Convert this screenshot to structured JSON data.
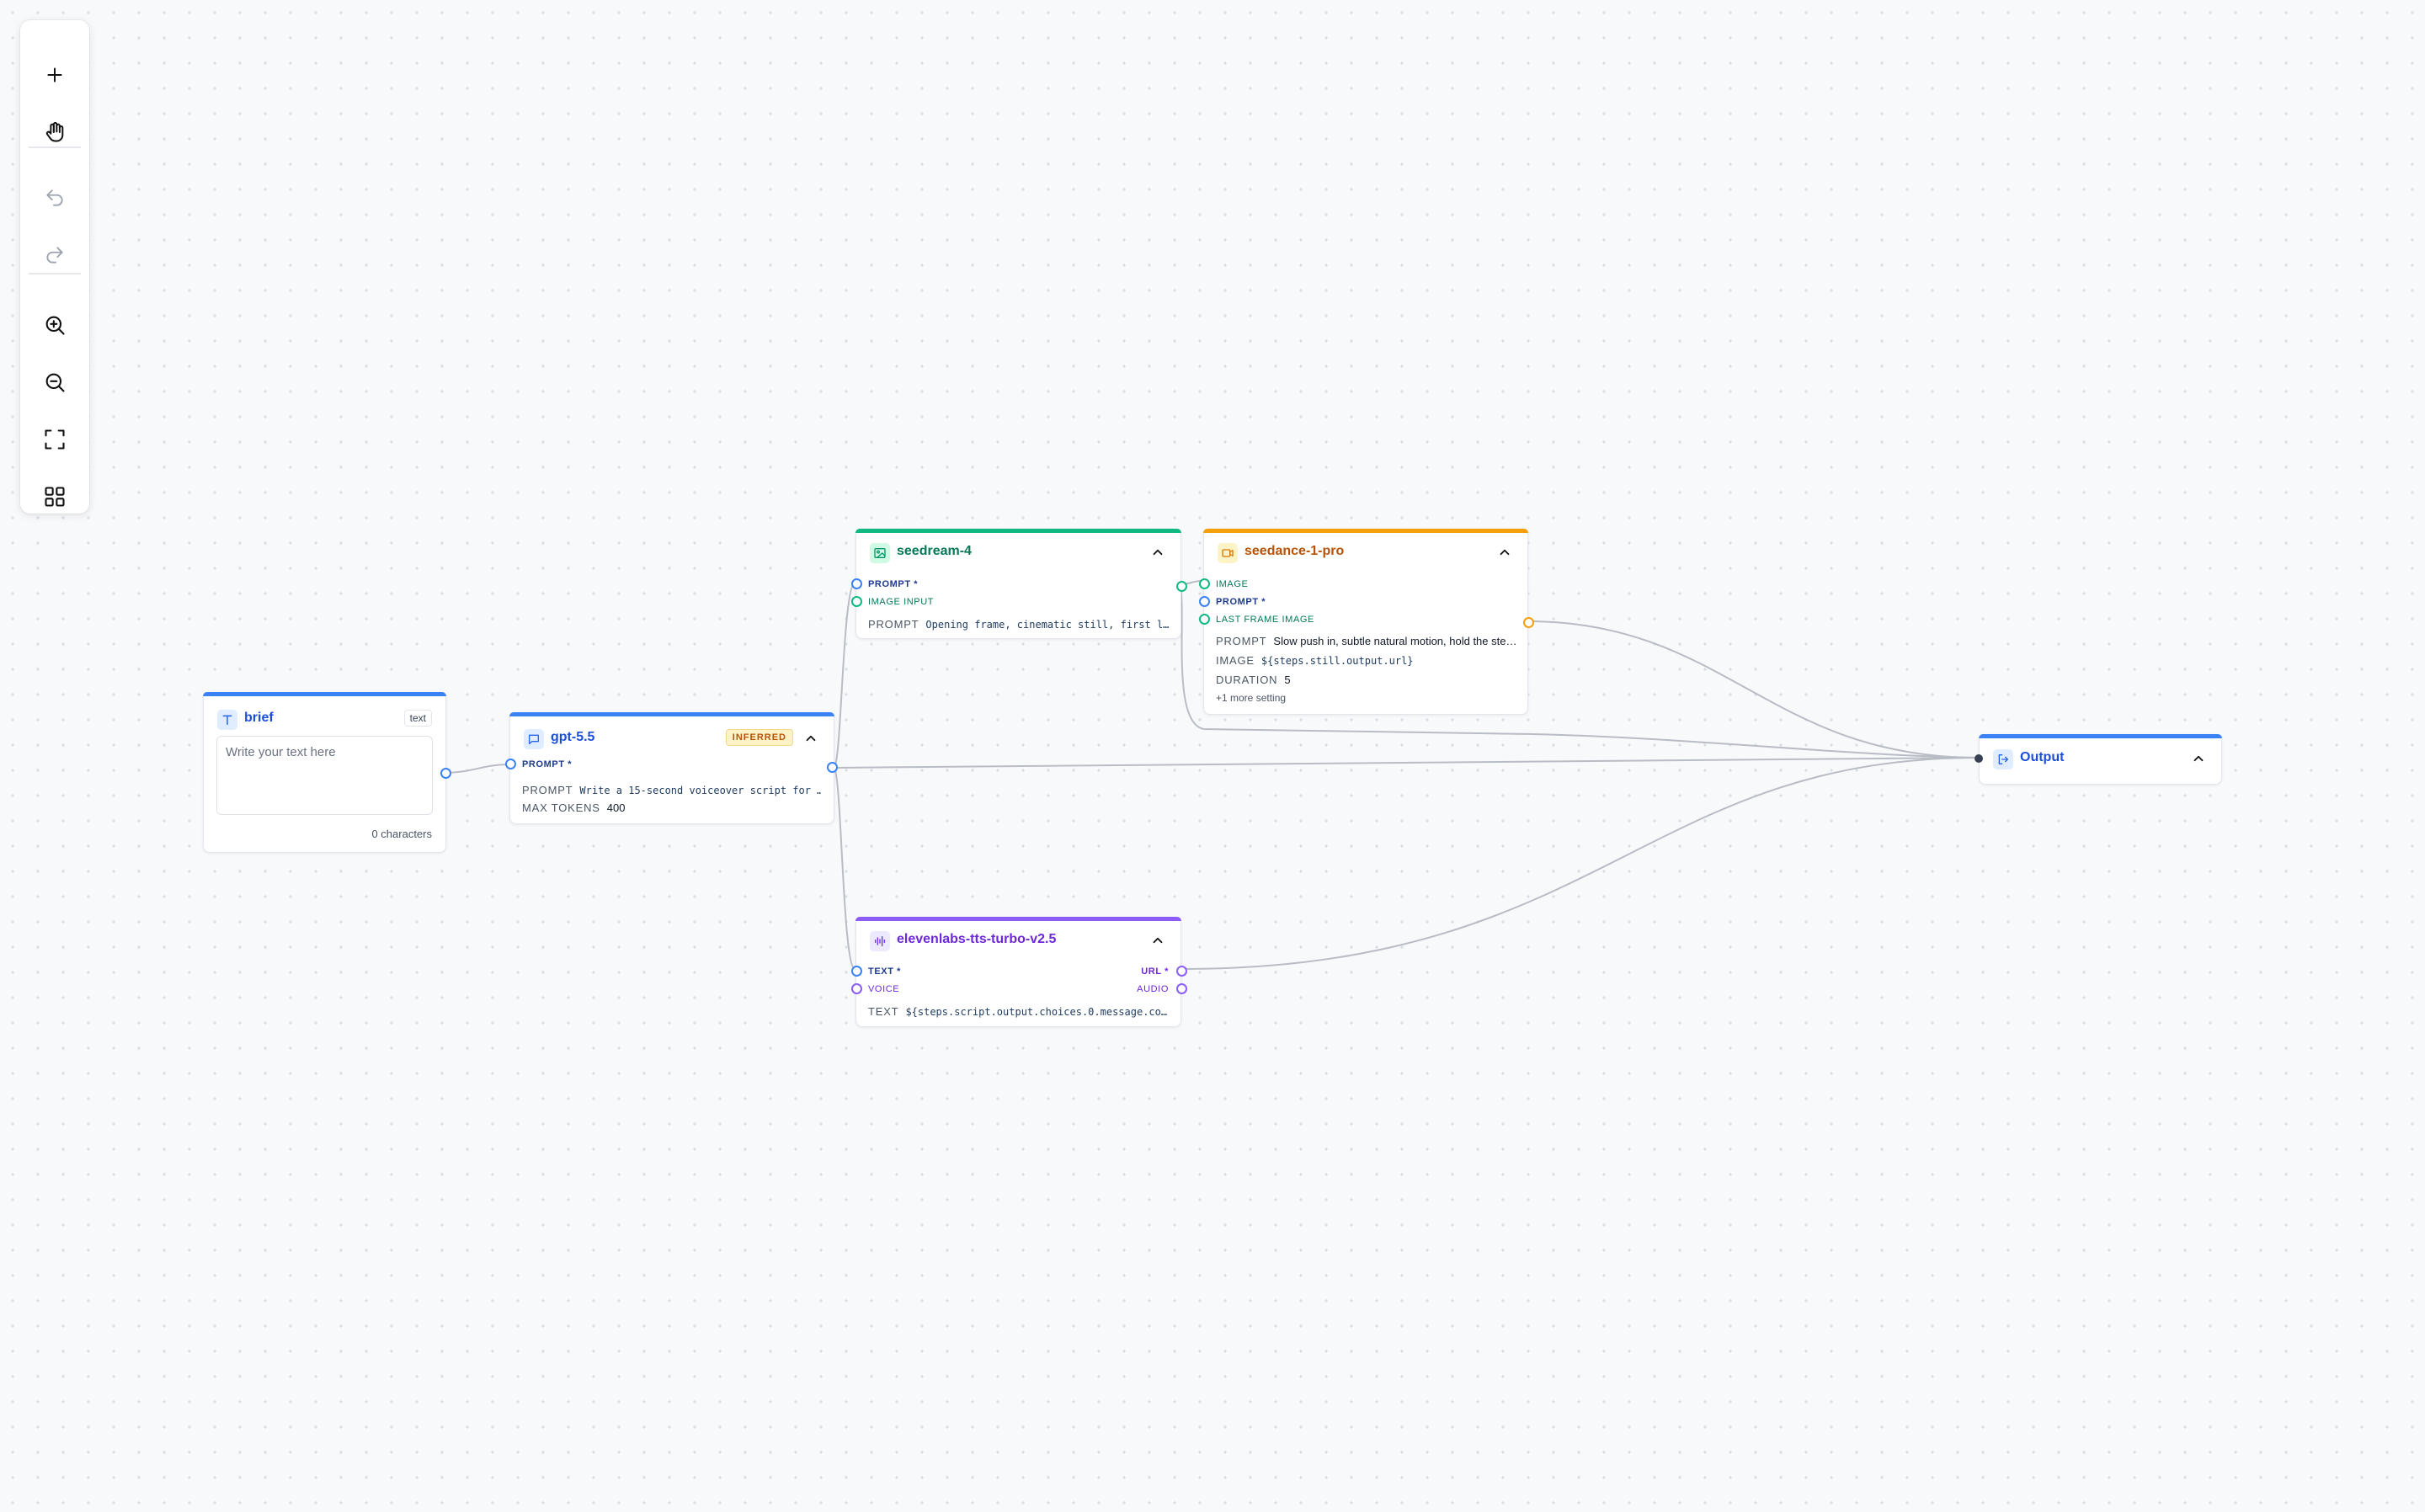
{
  "toolbar": {
    "items": [
      {
        "icon": "plus-icon",
        "enabled": true
      },
      {
        "icon": "hand-icon",
        "enabled": true
      },
      {
        "icon": "undo-icon",
        "enabled": false
      },
      {
        "icon": "redo-icon",
        "enabled": false
      },
      {
        "icon": "zoom-in-icon",
        "enabled": true
      },
      {
        "icon": "zoom-out-icon",
        "enabled": true
      },
      {
        "icon": "fit-view-icon",
        "enabled": true
      },
      {
        "icon": "grid-icon",
        "enabled": true
      }
    ]
  },
  "nodes": {
    "brief": {
      "title": "brief",
      "type_badge": "text",
      "placeholder": "Write your text here",
      "char_count": "0 characters",
      "accent": "#3b82f6"
    },
    "gpt": {
      "title": "gpt-5.5",
      "badge": "INFERRED",
      "ports": [
        "PROMPT *"
      ],
      "params": [
        {
          "key": "PROMPT",
          "value": "Write a 15-second voiceover script for …"
        },
        {
          "key": "MAX TOKENS",
          "value": "400"
        }
      ],
      "accent": "#3b82f6"
    },
    "seedream": {
      "title": "seedream-4",
      "ports": [
        "PROMPT *",
        "IMAGE INPUT"
      ],
      "params": [
        {
          "key": "PROMPT",
          "value": "Opening frame, cinematic still, first l…"
        }
      ],
      "accent": "#10b981"
    },
    "seedance": {
      "title": "seedance-1-pro",
      "ports": [
        "IMAGE",
        "PROMPT *",
        "LAST FRAME IMAGE"
      ],
      "params": [
        {
          "key": "PROMPT",
          "value": "Slow push in, subtle natural motion, hold the ste…"
        },
        {
          "key": "IMAGE",
          "value": "${steps.still.output.url}"
        },
        {
          "key": "DURATION",
          "value": "5"
        }
      ],
      "more": "+1 more setting",
      "accent": "#f59e0b"
    },
    "tts": {
      "title": "elevenlabs-tts-turbo-v2.5",
      "inputs": [
        "TEXT *",
        "VOICE"
      ],
      "outputs": [
        "URL *",
        "AUDIO"
      ],
      "params": [
        {
          "key": "TEXT",
          "value": "${steps.script.output.choices.0.message.co…"
        }
      ],
      "accent": "#8b5cf6"
    },
    "output": {
      "title": "Output",
      "accent": "#3b82f6"
    }
  }
}
